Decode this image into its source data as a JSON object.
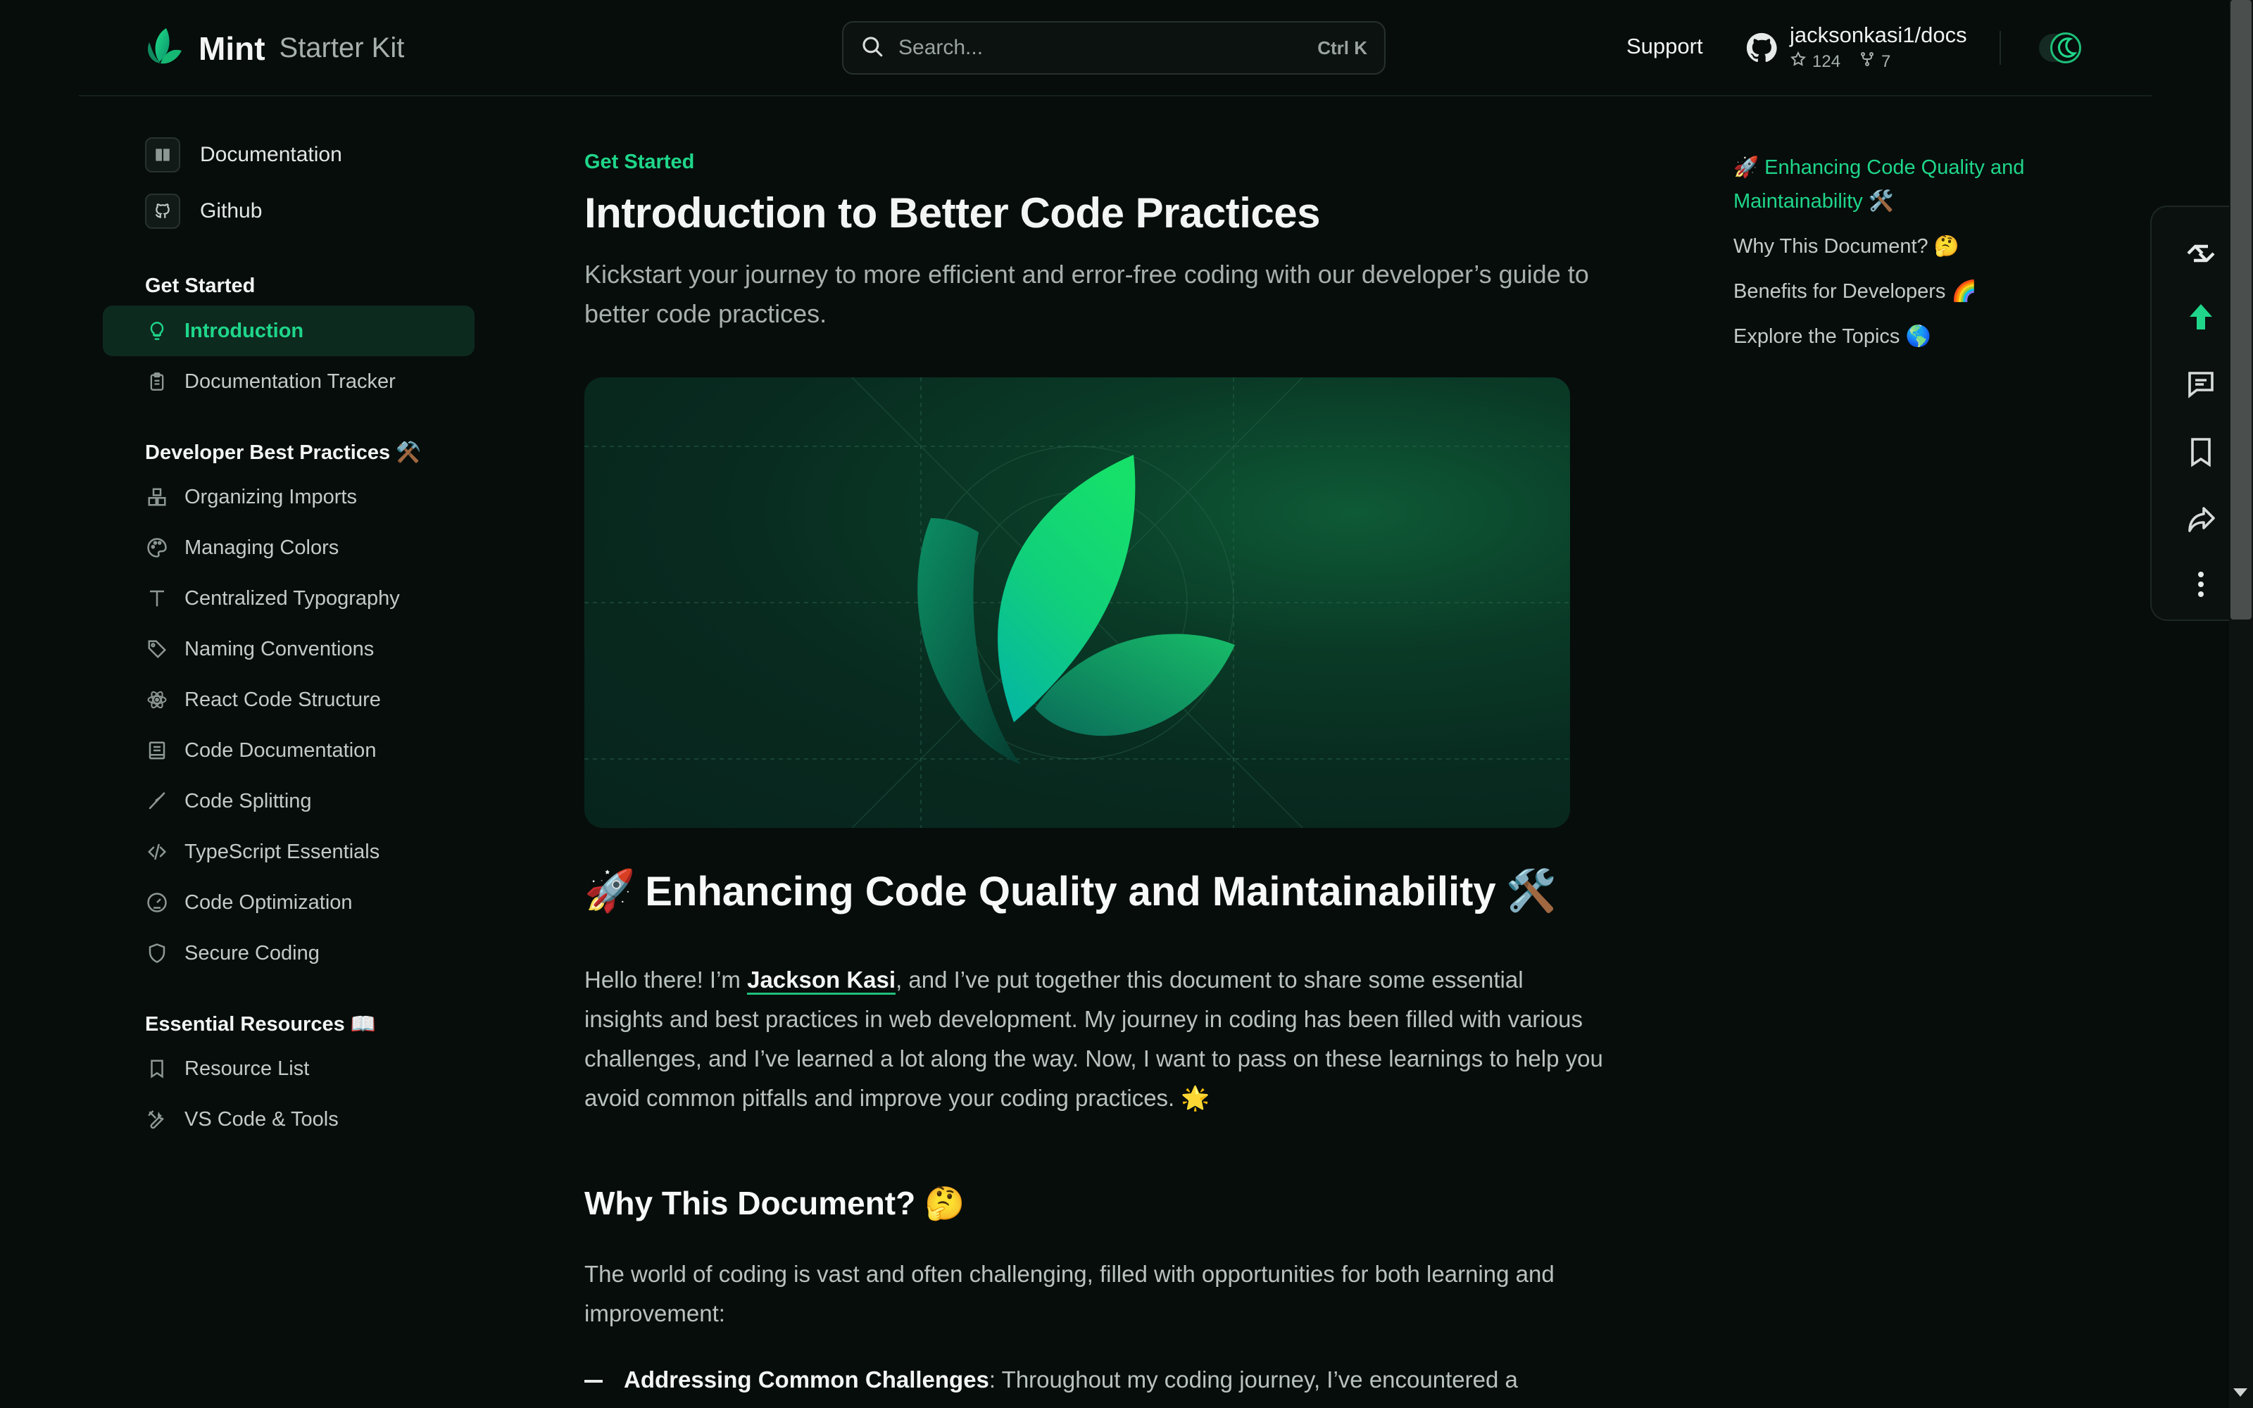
{
  "header": {
    "logo_name": "Mint",
    "logo_sub": "Starter Kit",
    "search_placeholder": "Search...",
    "search_shortcut": "Ctrl K",
    "support_label": "Support",
    "repo_name": "jacksonkasi1/docs",
    "repo_stars": "124",
    "repo_forks": "7"
  },
  "sidebar": {
    "anchors": [
      {
        "label": "Documentation",
        "icon": "book-icon"
      },
      {
        "label": "Github",
        "icon": "github-icon"
      }
    ],
    "groups": [
      {
        "title": "Get Started",
        "items": [
          {
            "label": "Introduction",
            "icon": "lightbulb-icon",
            "active": true
          },
          {
            "label": "Documentation Tracker",
            "icon": "clipboard-icon"
          }
        ]
      },
      {
        "title": "Developer Best Practices ⚒️",
        "items": [
          {
            "label": "Organizing Imports",
            "icon": "boxes-icon"
          },
          {
            "label": "Managing Colors",
            "icon": "palette-icon"
          },
          {
            "label": "Centralized Typography",
            "icon": "type-icon"
          },
          {
            "label": "Naming Conventions",
            "icon": "tag-icon"
          },
          {
            "label": "React Code Structure",
            "icon": "react-icon"
          },
          {
            "label": "Code Documentation",
            "icon": "book-open-icon"
          },
          {
            "label": "Code Splitting",
            "icon": "slash-icon"
          },
          {
            "label": "TypeScript Essentials",
            "icon": "code-icon"
          },
          {
            "label": "Code Optimization",
            "icon": "gauge-icon"
          },
          {
            "label": "Secure Coding",
            "icon": "shield-icon"
          }
        ]
      },
      {
        "title": "Essential Resources 📖",
        "items": [
          {
            "label": "Resource List",
            "icon": "bookmark-icon"
          },
          {
            "label": "VS Code & Tools",
            "icon": "tools-icon"
          }
        ]
      }
    ]
  },
  "main": {
    "eyebrow": "Get Started",
    "title": "Introduction to Better Code Practices",
    "description": "Kickstart your journey to more efficient and error-free coding with our developer’s guide to better code practices.",
    "section1": {
      "emoji_left": "🚀",
      "title": "Enhancing Code Quality and Maintainability",
      "emoji_right": "🛠️"
    },
    "intro": {
      "before_link": "Hello there! I’m ",
      "link_text": "Jackson Kasi",
      "after_link": ", and I’ve put together this document to share some essential insights and best practices in web development. My journey in coding has been filled with various challenges, and I’ve learned a lot along the way. Now, I want to pass on these learnings to help you avoid common pitfalls and improve your coding practices. 🌟"
    },
    "section2_title": "Why This Document? 🤔",
    "why_text": "The world of coding is vast and often challenging, filled with opportunities for both learning and improvement:",
    "list_first": {
      "bold": "Addressing Common Challenges",
      "text": ": Throughout my coding journey, I’ve encountered a"
    }
  },
  "toc": [
    {
      "label": "🚀 Enhancing Code Quality and Maintainability 🛠️",
      "active": true
    },
    {
      "label": "Why This Document? 🤔",
      "active": false
    },
    {
      "label": "Benefits for Developers 🌈",
      "active": false
    },
    {
      "label": "Explore the Topics 🌎",
      "active": false
    }
  ],
  "toolbar": [
    "diff-icon",
    "arrow-up-icon",
    "comment-icon",
    "bookmark-icon",
    "share-icon",
    "more-vertical-icon"
  ],
  "colors": {
    "accent": "#1fd68a",
    "background": "#070d0b"
  }
}
